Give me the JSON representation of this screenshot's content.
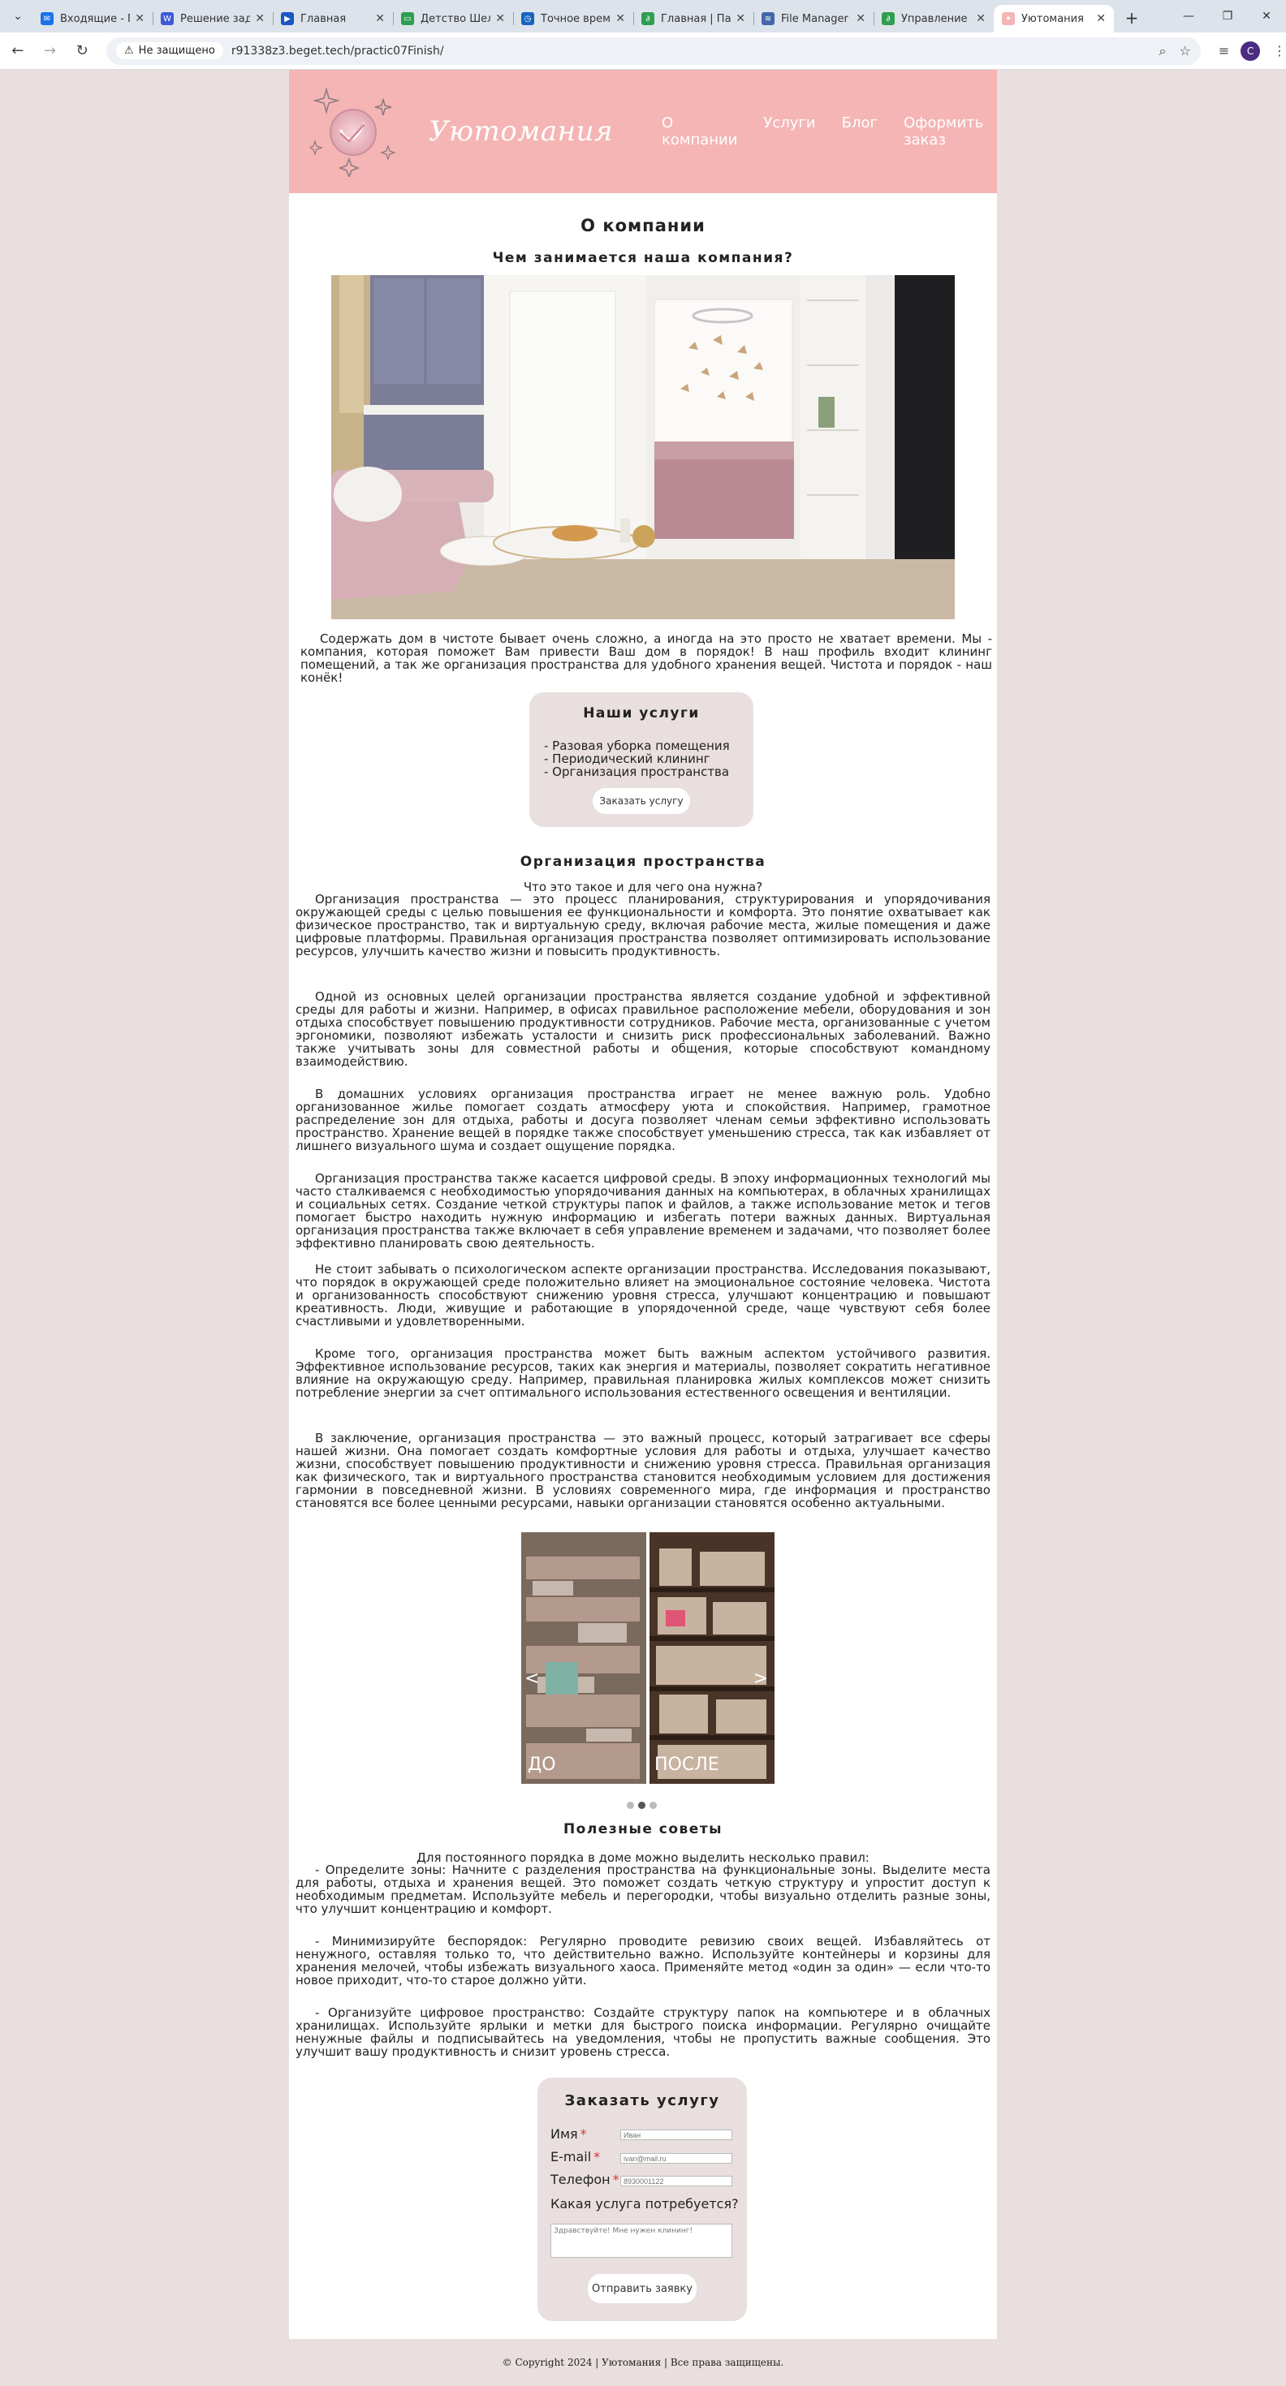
{
  "browser": {
    "tabs": [
      {
        "title": "Входящие - П",
        "color": "#1a73e8",
        "glyph": "✉"
      },
      {
        "title": "Решение зада",
        "color": "#3b5bdb",
        "glyph": "W"
      },
      {
        "title": "Главная",
        "color": "#1a56c4",
        "glyph": "▶"
      },
      {
        "title": "Детство Шелд",
        "color": "#2e9e4f",
        "glyph": "▭"
      },
      {
        "title": "Точное время",
        "color": "#1565c0",
        "glyph": "◷"
      },
      {
        "title": "Главная | Пан",
        "color": "#2e9e4f",
        "glyph": "∂"
      },
      {
        "title": "File Manager",
        "color": "#4466aa",
        "glyph": "≋"
      },
      {
        "title": "Управление с",
        "color": "#2e9e4f",
        "glyph": "∂"
      },
      {
        "title": "Уютомания",
        "color": "#f4b5b4",
        "glyph": "✦",
        "active": true
      }
    ],
    "security_label": "Не защищено",
    "url": "r91338z3.beget.tech/practic07Finish/",
    "profile_initial": "C"
  },
  "site": {
    "brand": "Уютомания",
    "nav": [
      "О компании",
      "Услуги",
      "Блог",
      "Оформить заказ"
    ],
    "page_title": "О компании",
    "subtitle": "Чем занимается наша компания?",
    "intro": "Содержать дом в чистоте бывает очень сложно, а иногда на это просто не хватает времени. Мы - компания, которая поможет Вам привести Ваш дом в порядок! В наш профиль входит клининг помещений, а так же организация пространства для удобного хранения вещей. Чистота и порядок - наш конёк!",
    "services": {
      "title": "Наши услуги",
      "items": [
        "- Разовая уборка помещения",
        "- Периодический клининг",
        "- Организация пространства"
      ],
      "button": "Заказать услугу"
    },
    "org": {
      "title": "Организация пространства",
      "lead": "Что это такое и для чего она нужна?",
      "paragraphs": [
        "Организация пространства — это процесс планирования, структурирования и упорядочивания окружающей среды с целью повышения ее функциональности и комфорта. Это понятие охватывает как физическое пространство, так и виртуальную среду, включая рабочие места, жилые помещения и даже цифровые платформы. Правильная организация пространства позволяет оптимизировать использование ресурсов, улучшить качество жизни и повысить продуктивность.",
        "Одной из основных целей организации пространства является создание удобной и эффективной среды для работы и жизни. Например, в офисах правильное расположение мебели, оборудования и зон отдыха способствует повышению продуктивности сотрудников. Рабочие места, организованные с учетом эргономики, позволяют избежать усталости и снизить риск профессиональных заболеваний. Важно также учитывать зоны для совместной работы и общения, которые способствуют командному взаимодействию.",
        "В домашних условиях организация пространства играет не менее важную роль. Удобно организованное жилье помогает создать атмосферу уюта и спокойствия. Например, грамотное распределение зон для отдыха, работы и досуга позволяет членам семьи эффективно использовать пространство. Хранение вещей в порядке также способствует уменьшению стресса, так как избавляет от лишнего визуального шума и создает ощущение порядка.",
        "Организация пространства также касается цифровой среды. В эпоху информационных технологий мы часто сталкиваемся с необходимостью упорядочивания данных на компьютерах, в облачных хранилищах и социальных сетях. Создание четкой структуры папок и файлов, а также использование меток и тегов помогает быстро находить нужную информацию и избегать потери важных данных. Виртуальная организация пространства также включает в себя управление временем и задачами, что позволяет более эффективно планировать свою деятельность.",
        "Не стоит забывать о психологическом аспекте организации пространства. Исследования показывают, что порядок в окружающей среде положительно влияет на эмоциональное состояние человека. Чистота и организованность способствуют снижению уровня стресса, улучшают концентрацию и повышают креативность. Люди, живущие и работающие в упорядоченной среде, чаще чувствуют себя более счастливыми и удовлетворенными.",
        "Кроме того, организация пространства может быть важным аспектом устойчивого развития. Эффективное использование ресурсов, таких как энергия и материалы, позволяет сократить негативное влияние на окружающую среду. Например, правильная планировка жилых комплексов может снизить потребление энергии за счет оптимального использования естественного освещения и вентиляции.",
        "В заключение, организация пространства — это важный процесс, который затрагивает все сферы нашей жизни. Она помогает создать комфортные условия для работы и отдыха, улучшает качество жизни, способствует повышению продуктивности и снижению уровня стресса. Правильная организация как физического, так и виртуального пространства становится необходимым условием для достижения гармонии в повседневной жизни. В условиях современного мира, где информация и пространство становятся все более ценными ресурсами, навыки организации становятся особенно актуальными."
      ]
    },
    "gallery": {
      "before": "ДО",
      "after": "ПОСЛЕ",
      "prev": "<",
      "next": ">",
      "slides": 3,
      "active_slide": 2
    },
    "tips": {
      "title": "Полезные советы",
      "lead": "Для постоянного порядка в доме можно выделить несколько правил:",
      "items": [
        "- Определите зоны: Начните с разделения пространства на функциональные зоны. Выделите места для работы, отдыха и хранения вещей. Это поможет создать четкую структуру и упростит доступ к необходимым предметам. Используйте мебель и перегородки, чтобы визуально отделить разные зоны, что улучшит концентрацию и комфорт.",
        "- Минимизируйте беспорядок: Регулярно проводите ревизию своих вещей. Избавляйтесь от ненужного, оставляя только то, что действительно важно. Используйте контейнеры и корзины для хранения мелочей, чтобы избежать визуального хаоса. Применяйте метод «один за один» — если что-то новое приходит, что-то старое должно уйти.",
        "- Организуйте цифровое пространство: Создайте структуру папок на компьютере и в облачных хранилищах. Используйте ярлыки и метки для быстрого поиска информации. Регулярно очищайте ненужные файлы и подписывайтесь на уведомления, чтобы не пропустить важные сообщения. Это улучшит вашу продуктивность и снизит уровень стресса."
      ]
    },
    "order": {
      "title": "Заказать услугу",
      "name_label": "Имя",
      "name_placeholder": "Иван",
      "email_label": "E-mail",
      "email_placeholder": "ivan@mail.ru",
      "phone_label": "Телефон",
      "phone_placeholder": "8930001122",
      "question": "Какая услуга потребуется?",
      "message_placeholder": "Здравствуйте! Мне нужен клининг!",
      "submit": "Отправить заявку"
    },
    "footer": "© Copyright 2024 | Уютомания | Все права защищены.",
    "colors": {
      "header": "#f4b5b4",
      "background": "#e8dfde",
      "accent": "#e0a5b0"
    }
  }
}
